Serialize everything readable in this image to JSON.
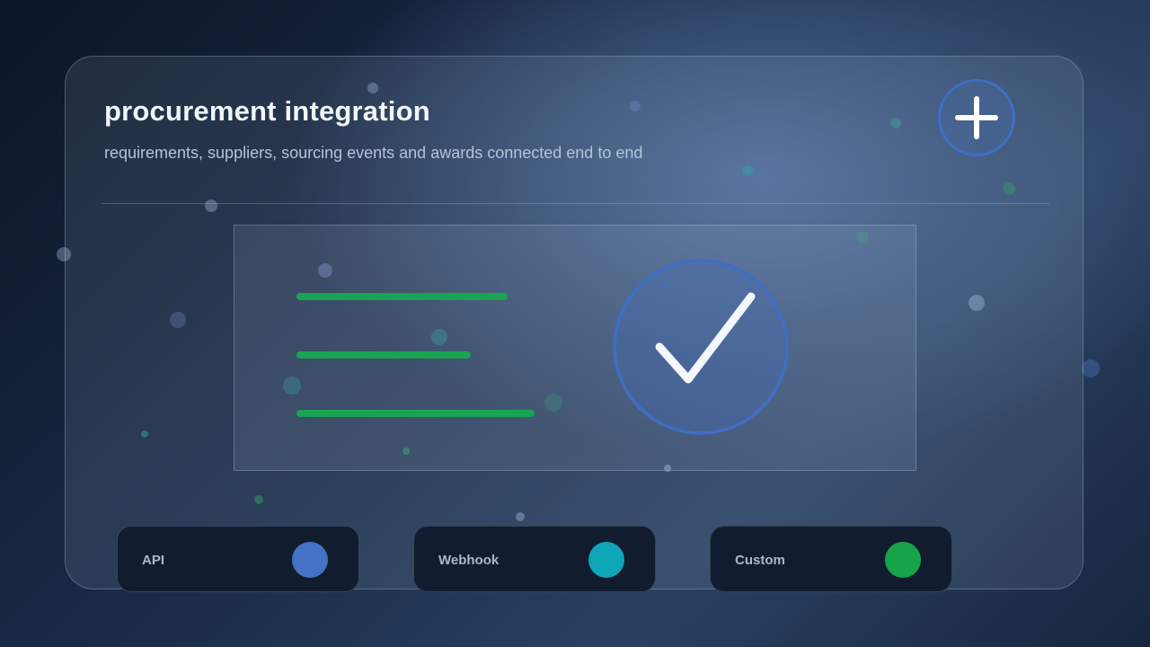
{
  "header": {
    "title": "procurement integration",
    "subtitle": "requirements, suppliers, sourcing events and awards connected end to end",
    "add_icon": "plus-icon"
  },
  "panel": {
    "line_icon_color": "#1aa352",
    "status_icon": "checkmark-circle-icon",
    "status_color": "#3f6fc4"
  },
  "chips": [
    {
      "label": "API",
      "dot_color": "#4472c4"
    },
    {
      "label": "Webhook",
      "dot_color": "#0ea5b7"
    },
    {
      "label": "Custom",
      "dot_color": "#16a34a"
    }
  ]
}
